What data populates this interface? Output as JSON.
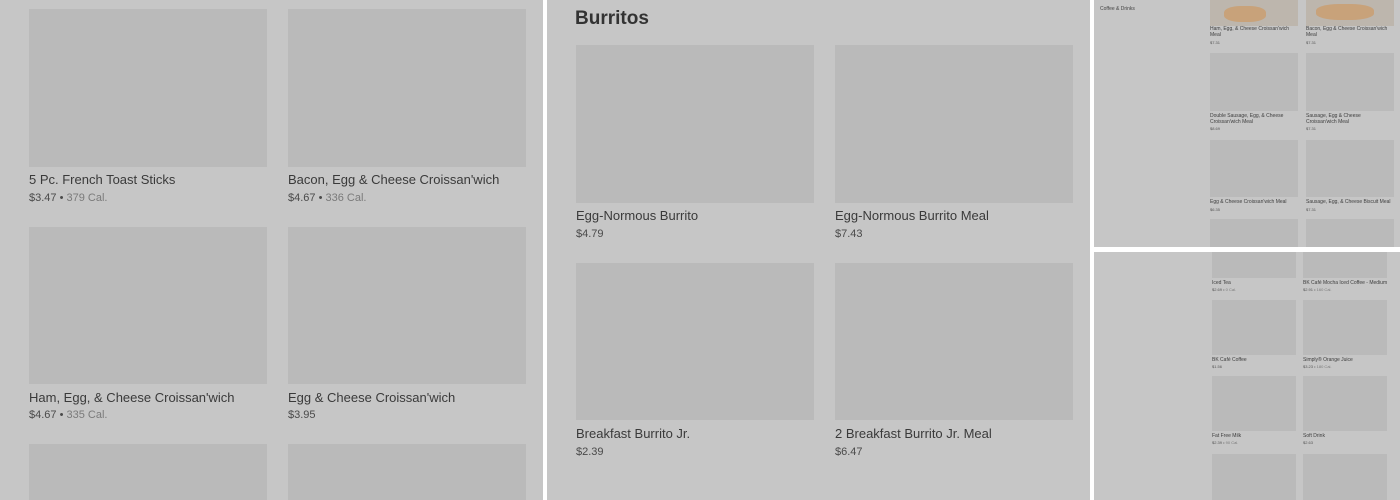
{
  "left_panel": {
    "items": [
      {
        "name": "5 Pc. French Toast Sticks",
        "price": "$3.47",
        "cal": "379 Cal."
      },
      {
        "name": "Bacon, Egg & Cheese Croissan'wich",
        "price": "$4.67",
        "cal": "336 Cal."
      },
      {
        "name": "Ham, Egg, & Cheese Croissan'wich",
        "price": "$4.67",
        "cal": "335 Cal."
      },
      {
        "name": "Egg & Cheese Croissan'wich",
        "price": "$3.95",
        "cal": ""
      }
    ]
  },
  "middle_panel": {
    "section_title": "Burritos",
    "items": [
      {
        "name": "Egg-Normous Burrito",
        "price": "$4.79"
      },
      {
        "name": "Egg-Normous Burrito Meal",
        "price": "$7.43"
      },
      {
        "name": "Breakfast Burrito Jr.",
        "price": "$2.39"
      },
      {
        "name": "2 Breakfast Burrito Jr. Meal",
        "price": "$6.47"
      }
    ]
  },
  "top_right_panel": {
    "category": "Coffee & Drinks",
    "items": [
      {
        "name": "Ham, Egg, & Cheese Croissan'wich Meal",
        "price": "$7.31"
      },
      {
        "name": "Bacon, Egg & Cheese Croissan'wich Meal",
        "price": "$7.31"
      },
      {
        "name": "Double Sausage, Egg, & Cheese Croissan'wich Meal",
        "price": "$8.69"
      },
      {
        "name": "Sausage, Egg & Cheese Croissan'wich Meal",
        "price": "$7.31"
      },
      {
        "name": "Egg & Cheese Croissan'wich Meal",
        "price": "$6.35"
      },
      {
        "name": "Sausage, Egg, & Cheese Biscuit Meal",
        "price": "$7.31"
      }
    ]
  },
  "bottom_right_panel": {
    "items": [
      {
        "name": "Iced Tea",
        "price": "$2.69",
        "cal": "0 Cal."
      },
      {
        "name": "BK Café Mocha Iced Coffee - Medium",
        "price": "$2.91",
        "cal": "160 Cal."
      },
      {
        "name": "BK Café Coffee",
        "price": "$1.56",
        "cal": ""
      },
      {
        "name": "Simply® Orange Juice",
        "price": "$3.23",
        "cal": "180 Cal."
      },
      {
        "name": "Fat Free Milk",
        "price": "$2.39",
        "cal": "90 Cal."
      },
      {
        "name": "Soft Drink",
        "price": "$2.63",
        "cal": ""
      }
    ]
  }
}
